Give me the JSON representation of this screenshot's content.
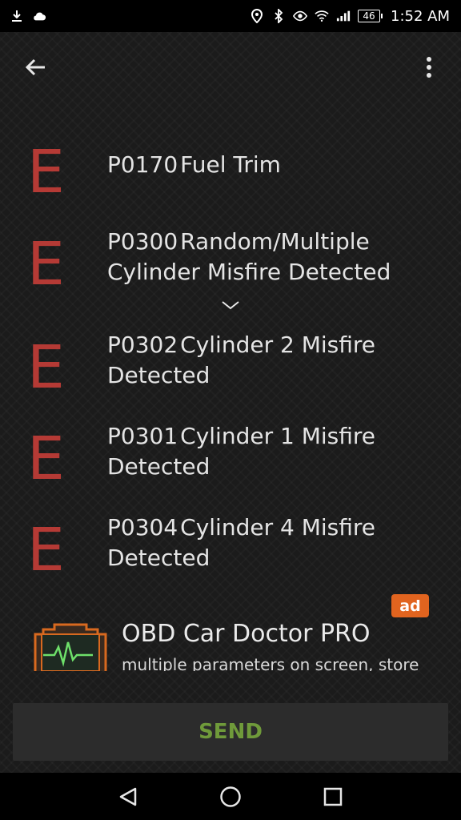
{
  "status_bar": {
    "time": "1:52 AM",
    "battery": "46",
    "icons": [
      "download-icon",
      "cloud-icon",
      "location-icon",
      "bluetooth-icon",
      "eye-icon",
      "wifi-icon",
      "signal-icon",
      "battery-icon"
    ]
  },
  "toolbar": {
    "back_icon": "arrow-left-icon",
    "menu_icon": "more-vert-icon"
  },
  "codes": [
    {
      "letter": "E",
      "code": "P0170",
      "line1": "Fuel Trim",
      "line2": ""
    },
    {
      "letter": "E",
      "code": "P0300",
      "line1": "Random/Multiple",
      "line2": "Cylinder Misfire Detected"
    },
    {
      "letter": "E",
      "code": "P0302",
      "line1": "Cylinder 2 Misfire",
      "line2": "Detected"
    },
    {
      "letter": "E",
      "code": "P0301",
      "line1": "Cylinder 1 Misfire",
      "line2": "Detected"
    },
    {
      "letter": "E",
      "code": "P0304",
      "line1": "Cylinder 4 Misfire",
      "line2": "Detected"
    }
  ],
  "ad": {
    "badge": "ad",
    "title": "OBD Car Doctor PRO",
    "description": "multiple parameters on screen, store"
  },
  "send_label": "SEND",
  "colors": {
    "error_letter": "#b53a35",
    "send_text": "#6f9a3a",
    "ad_badge": "#e1641f"
  }
}
